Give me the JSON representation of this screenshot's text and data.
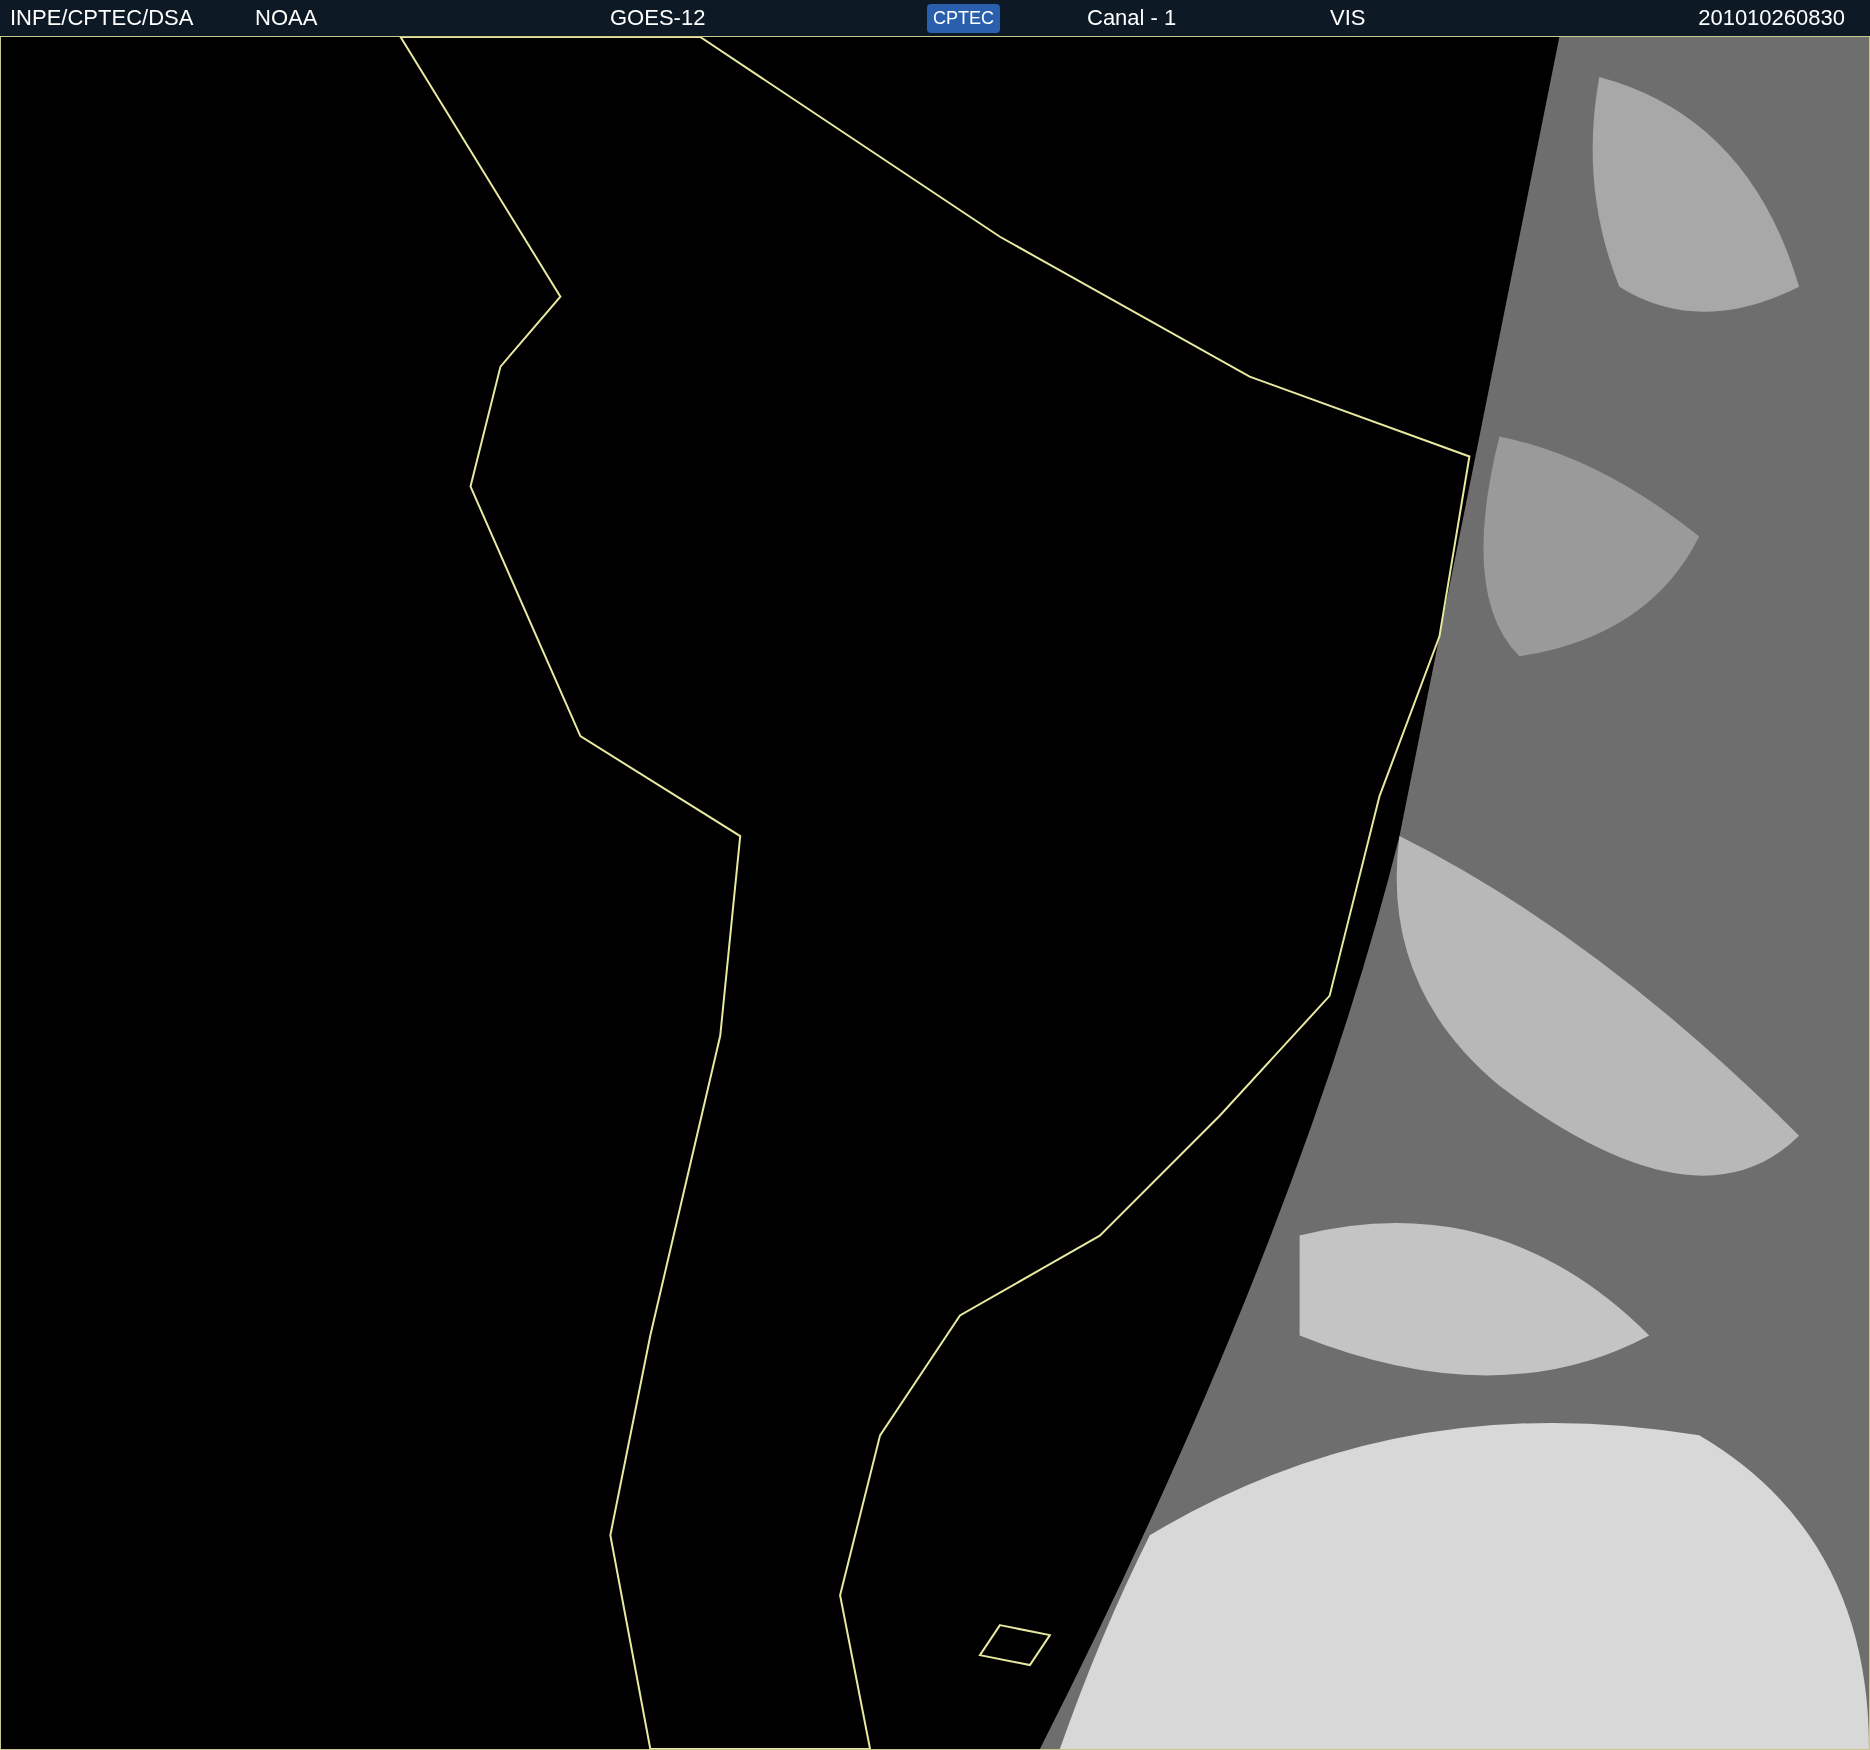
{
  "header": {
    "items": [
      "INPE/CPTEC/DSA",
      "NOAA",
      "GOES-12"
    ],
    "logo": "CPTEC",
    "items_right": [
      "Canal - 1",
      "VIS"
    ],
    "timestamp": "201010260830"
  }
}
